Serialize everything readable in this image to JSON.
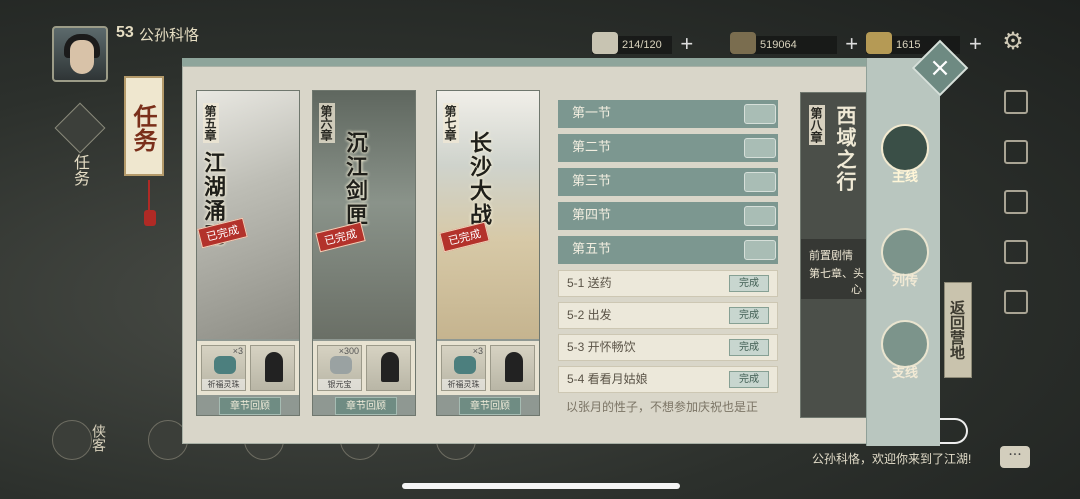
{
  "player": {
    "level": "53",
    "name": "公孙科恪"
  },
  "resources": [
    {
      "name": "stamina",
      "value": "214/120",
      "icon": "tea-icon",
      "color": "#c8c4b2"
    },
    {
      "name": "silver",
      "value": "519064",
      "icon": "ingot-icon",
      "color": "#7a6d4f"
    },
    {
      "name": "gold",
      "value": "1615",
      "icon": "gold-icon",
      "color": "#b59a55"
    }
  ],
  "left_nav": {
    "quest_label": "任务"
  },
  "dialog": {
    "title": "任务",
    "chapters": [
      {
        "number": "第五章",
        "title": "江湖涌动",
        "status": "已完成",
        "review": "章节回顾",
        "rewards": [
          {
            "qty": "×3",
            "name": "祈福灵珠"
          },
          {
            "qty": "",
            "name": ""
          }
        ],
        "scene_color": "#c8c7c0"
      },
      {
        "number": "第六章",
        "title": "沉江剑匣",
        "status": "已完成",
        "review": "章节回顾",
        "rewards": [
          {
            "qty": "×300",
            "name": "银元宝"
          },
          {
            "qty": "",
            "name": ""
          }
        ],
        "scene_color": "#6a7168"
      },
      {
        "number": "第七章",
        "title": "长沙大战",
        "status": "已完成",
        "review": "章节回顾",
        "rewards": [
          {
            "qty": "×3",
            "name": "祈福灵珠"
          },
          {
            "qty": "",
            "name": ""
          }
        ],
        "scene_color": "#cfc3a6"
      }
    ],
    "sections": [
      {
        "label": "第一节"
      },
      {
        "label": "第二节"
      },
      {
        "label": "第三节"
      },
      {
        "label": "第四节"
      },
      {
        "label": "第五节"
      }
    ],
    "subquests": [
      {
        "label": "5-1 送药",
        "status": "完成"
      },
      {
        "label": "5-2 出发",
        "status": "完成"
      },
      {
        "label": "5-3 开怀畅饮",
        "status": "完成"
      },
      {
        "label": "5-4 看看月姑娘",
        "status": "完成"
      }
    ],
    "quote": "以张月的性子，不想参加庆祝也是正",
    "locked_chapter": {
      "number": "第八章",
      "title": "西域之行",
      "prereq": "前置剧情",
      "prereq_detail": "第七章、头",
      "prereq_suffix": "心"
    },
    "rail_tabs": [
      {
        "label": "主线",
        "active": true
      },
      {
        "label": "列传",
        "active": false
      },
      {
        "label": "支线",
        "active": false
      }
    ],
    "close": "×"
  },
  "right_hud": {
    "return_label": "返回营地"
  },
  "bottom_hud": {
    "hero_label": "侠客"
  },
  "chat": {
    "message": "公孙科恪，欢迎你来到了江湖!",
    "button": "···"
  }
}
